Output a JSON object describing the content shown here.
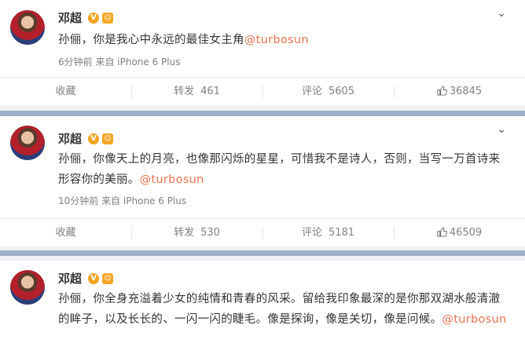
{
  "posts": [
    {
      "author": "邓超",
      "content": "孙俪，你是我心中永远的最佳女主角",
      "mention": "@turbosun",
      "time": "6分钟前",
      "source": "来自 iPhone 6 Plus",
      "actions": {
        "collect": "收藏",
        "repost_label": "转发",
        "repost": "461",
        "comment_label": "评论",
        "comment": "5605",
        "like": "36845"
      }
    },
    {
      "author": "邓超",
      "content": "孙俪，你像天上的月亮，也像那闪烁的星星，可惜我不是诗人，否则，当写一万首诗来形容你的美丽。",
      "mention": "@turbosun",
      "time": "10分钟前",
      "source": "来自 iPhone 6 Plus",
      "actions": {
        "collect": "收藏",
        "repost_label": "转发",
        "repost": "530",
        "comment_label": "评论",
        "comment": "5181",
        "like": "46509"
      }
    },
    {
      "author": "邓超",
      "content": "孙俪，你全身充溢着少女的纯情和青春的风采。留给我印象最深的是你那双湖水般清澈的眸子，以及长长的、一闪一闪的睫毛。像是探询，像是关切，像是问候。",
      "mention": "@turbosun"
    }
  ],
  "icons": {
    "verified": "V",
    "medal": "medal-icon",
    "expand": "chevron-down-icon",
    "like": "thumbs-up-icon"
  },
  "colors": {
    "mention": "#eb7350",
    "separator": "#9cb0c8",
    "verified": "#f3a320"
  }
}
